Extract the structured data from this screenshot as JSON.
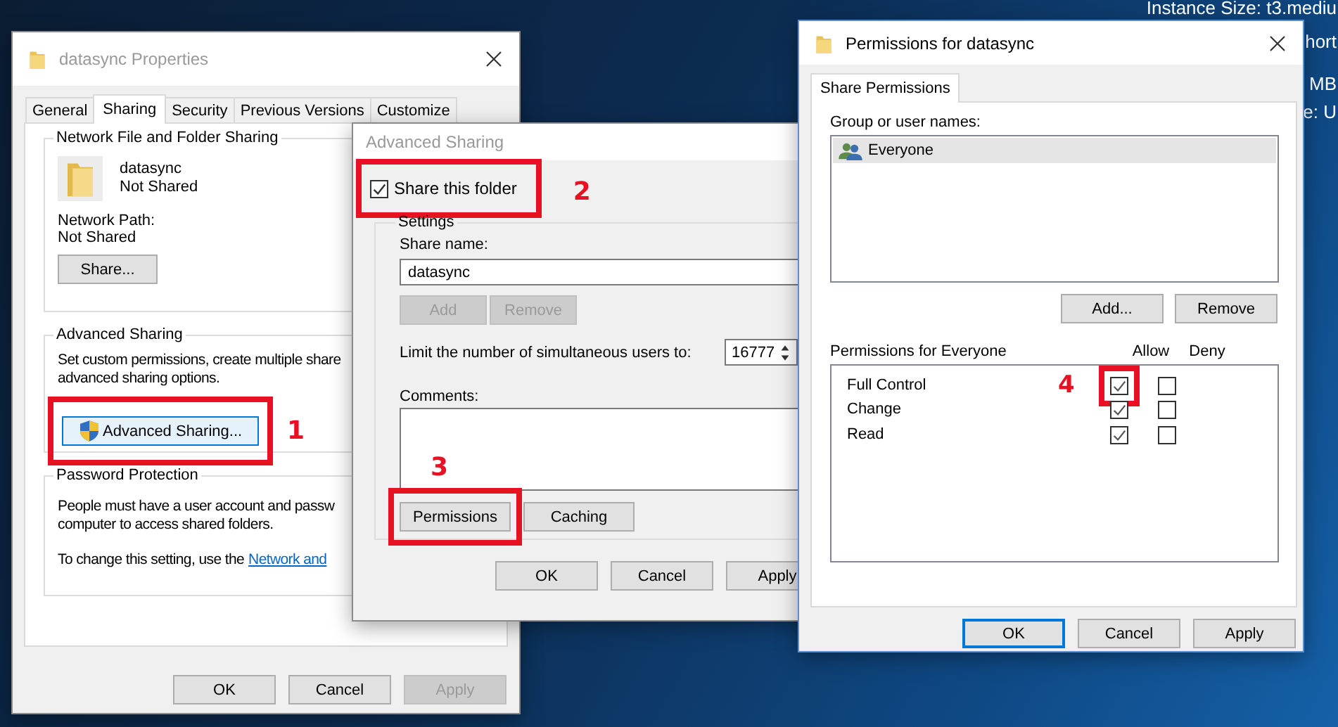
{
  "desktop": {
    "texts": [
      "Instance Size: t3.mediu",
      "hort",
      "MB",
      "e: U"
    ]
  },
  "properties_window": {
    "title": "datasync Properties",
    "active": false,
    "tabs": [
      {
        "label": "General",
        "selected": false
      },
      {
        "label": "Sharing",
        "selected": true
      },
      {
        "label": "Security",
        "selected": false
      },
      {
        "label": "Previous Versions",
        "selected": false
      },
      {
        "label": "Customize",
        "selected": false
      }
    ],
    "network_sharing": {
      "heading": "Network File and Folder Sharing",
      "name": "datasync",
      "status": "Not Shared",
      "path_label": "Network Path:",
      "path": "Not Shared",
      "share_button": "Share..."
    },
    "advanced_sharing": {
      "heading": "Advanced Sharing",
      "description": "Set custom permissions, create multiple share\nadvanced sharing options.",
      "button": {
        "label": "Advanced Sharing...",
        "highlighted": true
      },
      "annotation": "1"
    },
    "password_protection": {
      "heading": "Password Protection",
      "description": "People must have a user account and passw\ncomputer to access shared folders.",
      "change_text": "To change this setting, use the",
      "link": "Network and"
    },
    "buttons": [
      {
        "label": "OK",
        "disabled": false
      },
      {
        "label": "Cancel",
        "disabled": false
      },
      {
        "label": "Apply",
        "disabled": true
      }
    ]
  },
  "advanced_sharing_window": {
    "title": "Advanced Sharing",
    "active": false,
    "share_checkbox": {
      "label": "Share this folder",
      "checked": true,
      "highlighted": true
    },
    "annotation": "2",
    "settings": {
      "heading": "Settings",
      "share_name_label": "Share name:",
      "share_name": "datasync",
      "name_buttons": [
        {
          "label": "Add",
          "disabled": true
        },
        {
          "label": "Remove",
          "disabled": true
        }
      ],
      "limit_label": "Limit the number of simultaneous users to:",
      "limit_value": "16777",
      "comments_label": "Comments:",
      "annotation": "3",
      "buttons": [
        {
          "label": "Permissions",
          "highlighted": true
        },
        {
          "label": "Caching",
          "highlighted": false
        }
      ]
    },
    "buttons": [
      {
        "label": "OK",
        "disabled": false
      },
      {
        "label": "Cancel",
        "disabled": false
      },
      {
        "label": "Apply",
        "disabled": false
      }
    ]
  },
  "permissions_window": {
    "title": "Permissions for datasync",
    "active": true,
    "tabs": [
      {
        "label": "Share Permissions",
        "selected": true
      }
    ],
    "group_label": "Group or user names:",
    "users": [
      {
        "name": "Everyone",
        "selected": true
      }
    ],
    "user_buttons": [
      "Add...",
      "Remove"
    ],
    "permissions_label": "Permissions for Everyone",
    "allow_header": "Allow",
    "deny_header": "Deny",
    "rows": [
      {
        "name": "Full Control",
        "allow": true,
        "deny": false,
        "allow_highlighted": true,
        "annotation": "4"
      },
      {
        "name": "Change",
        "allow": true,
        "deny": false,
        "allow_highlighted": false
      },
      {
        "name": "Read",
        "allow": true,
        "deny": false,
        "allow_highlighted": false
      }
    ],
    "buttons": [
      {
        "label": "OK",
        "default": true
      },
      {
        "label": "Cancel",
        "default": false
      },
      {
        "label": "Apply",
        "default": false
      }
    ]
  }
}
